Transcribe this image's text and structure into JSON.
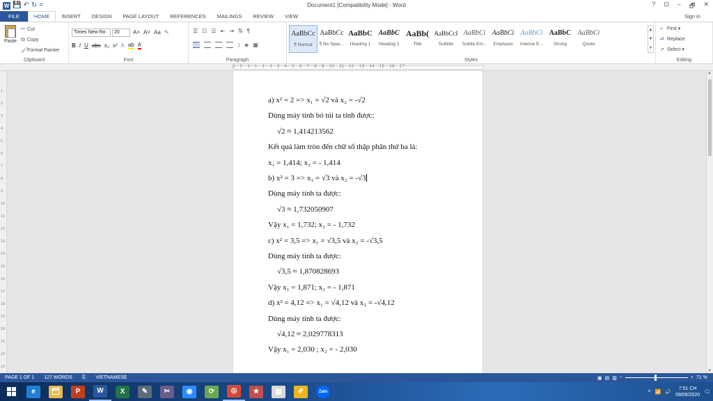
{
  "window": {
    "title": "Document1 [Compatibility Mode] - Word",
    "controls": [
      "?",
      "⊡",
      "–",
      "🗗",
      "✕"
    ]
  },
  "quick_access": {
    "save": "💾",
    "undo": "↶",
    "redo": "↻",
    "more": "="
  },
  "tabs": [
    "FILE",
    "HOME",
    "INSERT",
    "DESIGN",
    "PAGE LAYOUT",
    "REFERENCES",
    "MAILINGS",
    "REVIEW",
    "VIEW"
  ],
  "active_tab": "HOME",
  "signin": "Sign in",
  "clipboard": {
    "paste": "Paste",
    "cut": "Cut",
    "copy": "Copy",
    "format_painter": "Format Painter",
    "label": "Clipboard"
  },
  "font": {
    "name": "Times New Ro",
    "size": "20",
    "label": "Font",
    "grow": "A˄",
    "shrink": "A˅",
    "case": "Aa",
    "clear": "✎",
    "bold": "B",
    "italic": "I",
    "underline": "U",
    "strike": "abc",
    "subscript": "x₂",
    "superscript": "x²"
  },
  "paragraph": {
    "label": "Paragraph",
    "pilcrow": "¶"
  },
  "styles": {
    "label": "Styles",
    "items": [
      {
        "preview": "AaBbCc",
        "name": "¶ Normal"
      },
      {
        "preview": "AaBbCc",
        "name": "¶ No Spac..."
      },
      {
        "preview": "AaBbC",
        "name": "Heading 1"
      },
      {
        "preview": "AaBbC",
        "name": "Heading 2"
      },
      {
        "preview": "AaBb(",
        "name": "Title"
      },
      {
        "preview": "AaBbCcI",
        "name": "Subtitle"
      },
      {
        "preview": "AaBbCi",
        "name": "Subtle Em..."
      },
      {
        "preview": "AaBbCi",
        "name": "Emphasis"
      },
      {
        "preview": "AaBbCi",
        "name": "Intense E..."
      },
      {
        "preview": "AaBbC",
        "name": "Strong"
      },
      {
        "preview": "AaBbCi",
        "name": "Quote"
      }
    ]
  },
  "editing": {
    "label": "Editing",
    "find": "Find",
    "replace": "Replace",
    "select": "Select"
  },
  "ruler": {
    "numbers": "3 · 2 · 1 · 1 · 1 · 2 · 3 · 4 · 5 · 6 · 7 · 8 · 9 · 10 · 11 · 12 · 13 · 14 · 15 · 16 · 17"
  },
  "document": {
    "lines": [
      {
        "text": "a) x² = 2 => x₁ = √2 và x₂ = -√2",
        "indent": false
      },
      {
        "text": "Dùng máy tính bỏ túi ta tính được:",
        "indent": false
      },
      {
        "text": "√2 ≈ 1,414213562",
        "indent": true
      },
      {
        "text": "Kết quả làm tròn đến chữ số thập phân thứ ba là:",
        "indent": false
      },
      {
        "text": "x₁ = 1,414; x₂ = - 1,414",
        "indent": false
      },
      {
        "text": "b) x² = 3 => x₁ = √3 và x₂ = -√3",
        "indent": false
      },
      {
        "text": "Dùng máy tính ta được:",
        "indent": false
      },
      {
        "text": "√3 ≈ 1,732050907",
        "indent": true
      },
      {
        "text": "Vậy x₁ = 1,732; x₂ = - 1,732",
        "indent": false
      },
      {
        "text": "c) x² = 3,5 => x₁ = √3,5 và x₂ = -√3,5",
        "indent": false
      },
      {
        "text": "Dùng máy tính ta được:",
        "indent": false
      },
      {
        "text": "√3,5 ≈ 1,870828693",
        "indent": true
      },
      {
        "text": "Vậy x₁ = 1,871; x₂ = - 1,871",
        "indent": false
      },
      {
        "text": "d) x² = 4,12 => x₁ = √4,12 và x₂ = -√4,12",
        "indent": false
      },
      {
        "text": "Dùng máy tính ta được:",
        "indent": false
      },
      {
        "text": "√4,12 ≈ 2,029778313",
        "indent": true
      },
      {
        "text": "Vậy x₁ = 2,030 ; x₂ = - 2,030",
        "indent": false
      }
    ],
    "cursor_line": 5
  },
  "status": {
    "page": "PAGE 1 OF 1",
    "words": "127 WORDS",
    "language": "VIETNAMESE",
    "zoom": "71 %"
  },
  "taskbar": {
    "apps": [
      {
        "name": "start",
        "label": "",
        "color": "#1d4f8f"
      },
      {
        "name": "edge",
        "label": "e",
        "color": "#1f7fd4"
      },
      {
        "name": "explorer",
        "label": "🗂",
        "color": "#e8b84a"
      },
      {
        "name": "powerpoint",
        "label": "P",
        "color": "#c43e1c"
      },
      {
        "name": "word",
        "label": "W",
        "color": "#2b579a"
      },
      {
        "name": "excel",
        "label": "X",
        "color": "#217346"
      },
      {
        "name": "paint3d",
        "label": "✎",
        "color": "#5b6b7b"
      },
      {
        "name": "snip",
        "label": "✂",
        "color": "#6a5b8c"
      },
      {
        "name": "zoom",
        "label": "◉",
        "color": "#2d8cff"
      },
      {
        "name": "geogebra",
        "label": "⟳",
        "color": "#6aa84f"
      },
      {
        "name": "chrome",
        "label": "◎",
        "color": "#d04a3a"
      },
      {
        "name": "pinned",
        "label": "★",
        "color": "#c0504d"
      },
      {
        "name": "paint",
        "label": "▧",
        "color": "#d9d9d9"
      },
      {
        "name": "notes",
        "label": "✐",
        "color": "#f1b51c"
      },
      {
        "name": "zalo",
        "label": "Zalo",
        "color": "#0068ff"
      }
    ],
    "time": "7:51 CH",
    "date": "09/09/2020"
  }
}
